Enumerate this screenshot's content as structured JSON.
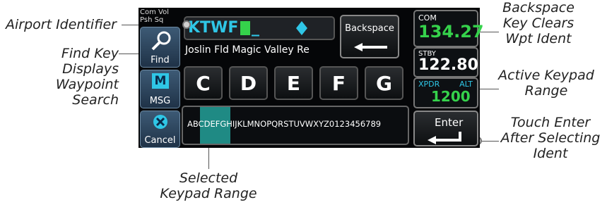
{
  "callouts": {
    "airport_identifier": "Airport Identifier",
    "find_key_line1": "Find Key Displays",
    "find_key_line2": "Waypoint Search",
    "backspace_line1": "Backspace",
    "backspace_line2": "Key Clears",
    "backspace_line3": "Wpt Ident",
    "active_keypad_line1": "Active Keypad",
    "active_keypad_line2": "Range",
    "touch_enter_line1": "Touch Enter",
    "touch_enter_line2": "After Selecting",
    "touch_enter_line3": "Ident",
    "selected_keypad_line1": "Selected",
    "selected_keypad_line2": "Keypad Range"
  },
  "screen": {
    "com_vol_line1": "Com Vol",
    "com_vol_line2": "Psh Sq",
    "ident_value": "KTWF",
    "cursor_char": "_",
    "waypoint_name": "Joslin Fld Magic Valley Re",
    "find_label": "Find",
    "msg_label": "MSG",
    "cancel_label": "Cancel",
    "backspace_label": "Backspace",
    "enter_label": "Enter",
    "keys": [
      "C",
      "D",
      "E",
      "F",
      "G"
    ],
    "range_selected": "ABCDEFG",
    "range_rest": "HIJKLMNOPQRSTUVWXYZ0123456789",
    "com_label": "COM",
    "com_freq": "134.27",
    "stby_label": "STBY",
    "stby_freq": "122.80",
    "xpdr_label": "XPDR",
    "alt_label": "ALT",
    "xpdr_code": "1200"
  },
  "colors": {
    "accent_cyan": "#2fc6e6",
    "green": "#35d24b",
    "teal_highlight": "#1f8a84"
  }
}
